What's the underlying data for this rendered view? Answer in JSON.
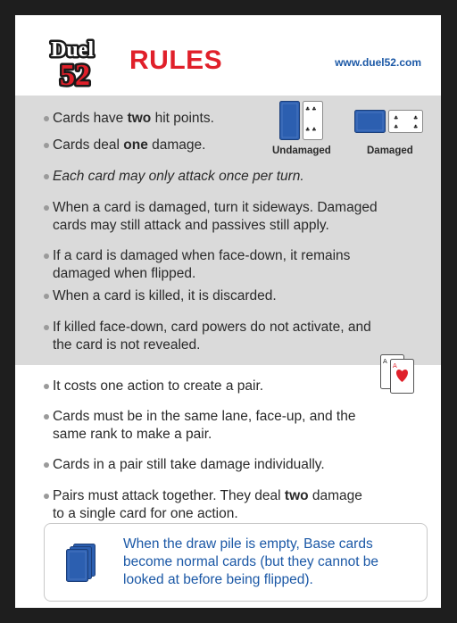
{
  "header": {
    "logo_text_top": "Duel",
    "logo_text_bottom": "52",
    "title": "RULES",
    "url": "www.duel52.com"
  },
  "card_examples": {
    "undamaged_label": "Undamaged",
    "damaged_label": "Damaged"
  },
  "rules_gray": [
    {
      "pre": "Cards have ",
      "bold": "two",
      "post": " hit points."
    },
    {
      "pre": "Cards deal ",
      "bold": "one",
      "post": " damage."
    },
    {
      "text": "Each card may only attack once per turn."
    },
    {
      "line1": "When a card is damaged, turn it sideways. Damaged",
      "line2": "cards may still attack and passives still apply."
    },
    {
      "line1": "If a card is damaged when face-down, it remains",
      "line2": "damaged when flipped."
    },
    {
      "text": "When a card is killed, it is discarded."
    },
    {
      "line1": "If killed face-down, card powers do not activate, and",
      "line2": "the card is not revealed."
    }
  ],
  "rules_white": [
    {
      "text": "It costs one action to create a pair."
    },
    {
      "line1": "Cards must be in the same lane, face-up, and the",
      "line2": "same rank to make a pair."
    },
    {
      "text": "Cards in a pair still take damage individually."
    },
    {
      "line1_pre": "Pairs must attack together. They deal ",
      "line1_bold": "two",
      "line1_post": " damage",
      "line2": "to a single card for one action."
    }
  ],
  "note": {
    "line1": "When the draw pile is empty, Base cards",
    "line2": "become normal cards (but they cannot be",
    "line3": "looked at before being flipped)."
  },
  "colors": {
    "title_red": "#e0202a",
    "link_blue": "#1b58a6",
    "card_back_blue": "#2c5fb0",
    "gray_band": "#dadada"
  },
  "icons": [
    "duel52-logo",
    "card-back-icon",
    "card-face-icon",
    "heart-icon",
    "card-stack-icon"
  ]
}
